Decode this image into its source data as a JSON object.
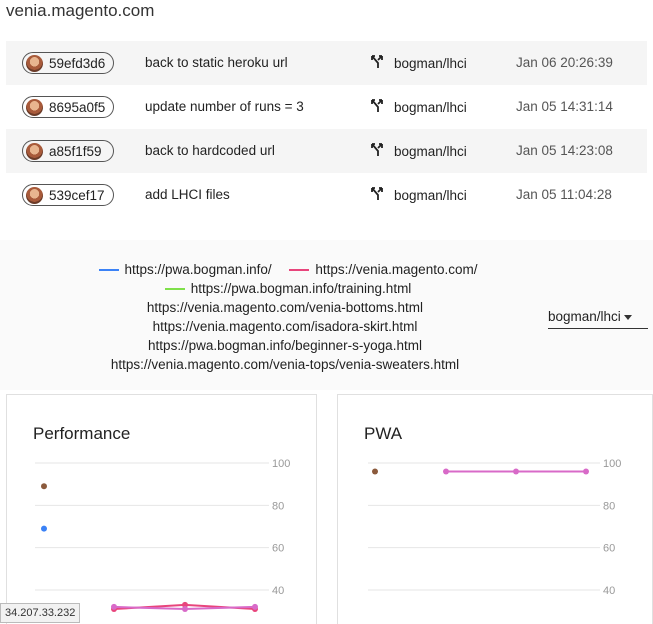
{
  "site": {
    "title": "venia.magento.com"
  },
  "commits": [
    {
      "hash": "59efd3d6",
      "message": "back to static heroku url",
      "repo": "bogman/lhci",
      "time": "Jan 06 20:26:39"
    },
    {
      "hash": "8695a0f5",
      "message": "update number of runs = 3",
      "repo": "bogman/lhci",
      "time": "Jan 05 14:31:14"
    },
    {
      "hash": "a85f1f59",
      "message": "back to hardcoded url",
      "repo": "bogman/lhci",
      "time": "Jan 05 14:23:08"
    },
    {
      "hash": "539cef17",
      "message": "add LHCI files",
      "repo": "bogman/lhci",
      "time": "Jan 05 11:04:28"
    }
  ],
  "legend": {
    "items": [
      {
        "url": "https://pwa.bogman.info/",
        "color": "#3b82f6"
      },
      {
        "url": "https://venia.magento.com/",
        "color": "#e8457c"
      },
      {
        "url": "https://pwa.bogman.info/training.html",
        "color": "#7fe04a"
      },
      {
        "url": "https://venia.magento.com/venia-bottoms.html",
        "color": ""
      },
      {
        "url": "https://venia.magento.com/isadora-skirt.html",
        "color": ""
      },
      {
        "url": "https://pwa.bogman.info/beginner-s-yoga.html",
        "color": ""
      },
      {
        "url": "https://venia.magento.com/venia-tops/venia-sweaters.html",
        "color": ""
      }
    ]
  },
  "branch_selector": {
    "value": "bogman/lhci",
    "icon": "caret-down-icon"
  },
  "footer": {
    "ip": "34.207.33.232"
  },
  "chart_data": [
    {
      "type": "line",
      "title": "Performance",
      "ylim": [
        40,
        100
      ],
      "yticks": [
        "100",
        "80",
        "60",
        "40"
      ],
      "grid": true,
      "series": [
        {
          "color": "#8b5a3c",
          "values": [
            89,
            null,
            null,
            null
          ]
        },
        {
          "color": "#3b82f6",
          "values": [
            69,
            null,
            null,
            null
          ]
        },
        {
          "color": "#e8457c",
          "values": [
            null,
            31,
            33,
            31
          ]
        },
        {
          "color": "#d86ac8",
          "values": [
            null,
            32,
            31,
            32
          ]
        }
      ]
    },
    {
      "type": "line",
      "title": "PWA",
      "ylim": [
        40,
        100
      ],
      "yticks": [
        "100",
        "80",
        "60",
        "40"
      ],
      "grid": true,
      "series": [
        {
          "color": "#8b5a3c",
          "values": [
            96,
            null,
            null,
            null
          ]
        },
        {
          "color": "#d86ac8",
          "values": [
            null,
            96,
            96,
            96
          ]
        }
      ]
    }
  ]
}
